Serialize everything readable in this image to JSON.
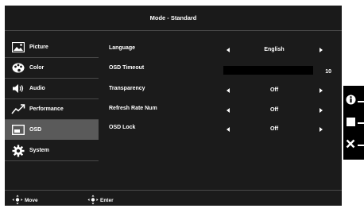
{
  "title": "Mode - Standard",
  "sidebar": {
    "items": [
      {
        "label": "Picture",
        "icon": "picture-icon",
        "active": false
      },
      {
        "label": "Color",
        "icon": "palette-icon",
        "active": false
      },
      {
        "label": "Audio",
        "icon": "speaker-icon",
        "active": false
      },
      {
        "label": "Performance",
        "icon": "performance-icon",
        "active": false
      },
      {
        "label": "OSD",
        "icon": "osd-icon",
        "active": true
      },
      {
        "label": "System",
        "icon": "gear-icon",
        "active": false
      }
    ]
  },
  "settings": {
    "language": {
      "label": "Language",
      "value": "English"
    },
    "osd_timeout": {
      "label": "OSD Timeout",
      "value": "10"
    },
    "transparency": {
      "label": "Transparency",
      "value": "Off"
    },
    "refresh_rate_num": {
      "label": "Refresh Rate Num",
      "value": "Off"
    },
    "osd_lock": {
      "label": "OSD Lock",
      "value": "Off"
    }
  },
  "footer": {
    "move_label": "Move",
    "enter_label": "Enter"
  },
  "side_panel": {
    "buttons": [
      "info-icon",
      "square-icon",
      "close-icon"
    ]
  },
  "colors": {
    "background": "#1b1b1b",
    "active_item": "#5a5a5a",
    "text": "#ffffff"
  }
}
